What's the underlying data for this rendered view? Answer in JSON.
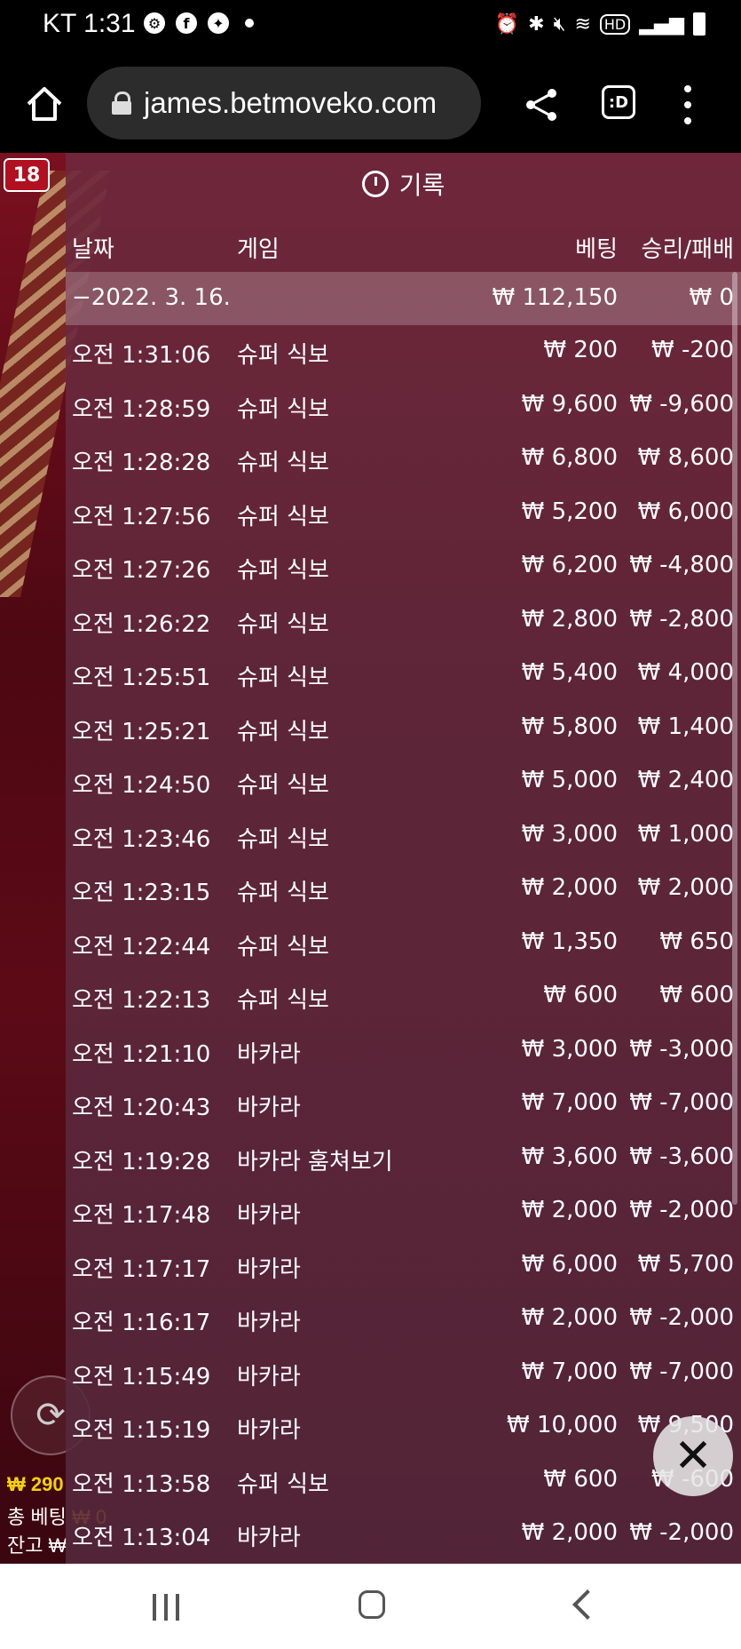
{
  "status_bar": {
    "carrier_time": "KT 1:31",
    "left_icons": [
      "settings-badge-icon",
      "facebook-icon",
      "messenger-icon"
    ],
    "right_hd": "HD"
  },
  "browser": {
    "url": "james.betmoveko.com",
    "tabs_label": ":D"
  },
  "game": {
    "badge": "18",
    "balance_amount": "₩ 290",
    "total_bet_label": "총 베팅",
    "total_bet_value": "₩ 0",
    "remaining_label": "잔고 ₩"
  },
  "history": {
    "title": "기록",
    "headers": {
      "date": "날짜",
      "game": "게임",
      "bet": "베팅",
      "result": "승리/패배"
    },
    "summary": {
      "date": "−2022. 3. 16.",
      "bet": "₩ 112,150",
      "result": "₩ 0"
    },
    "rows": [
      {
        "time": "오전 1:31:06",
        "game": "슈퍼 식보",
        "bet": "₩ 200",
        "result": "₩ -200"
      },
      {
        "time": "오전 1:28:59",
        "game": "슈퍼 식보",
        "bet": "₩ 9,600",
        "result": "₩ -9,600"
      },
      {
        "time": "오전 1:28:28",
        "game": "슈퍼 식보",
        "bet": "₩ 6,800",
        "result": "₩ 8,600"
      },
      {
        "time": "오전 1:27:56",
        "game": "슈퍼 식보",
        "bet": "₩ 5,200",
        "result": "₩ 6,000"
      },
      {
        "time": "오전 1:27:26",
        "game": "슈퍼 식보",
        "bet": "₩ 6,200",
        "result": "₩ -4,800"
      },
      {
        "time": "오전 1:26:22",
        "game": "슈퍼 식보",
        "bet": "₩ 2,800",
        "result": "₩ -2,800"
      },
      {
        "time": "오전 1:25:51",
        "game": "슈퍼 식보",
        "bet": "₩ 5,400",
        "result": "₩ 4,000"
      },
      {
        "time": "오전 1:25:21",
        "game": "슈퍼 식보",
        "bet": "₩ 5,800",
        "result": "₩ 1,400"
      },
      {
        "time": "오전 1:24:50",
        "game": "슈퍼 식보",
        "bet": "₩ 5,000",
        "result": "₩ 2,400"
      },
      {
        "time": "오전 1:23:46",
        "game": "슈퍼 식보",
        "bet": "₩ 3,000",
        "result": "₩ 1,000"
      },
      {
        "time": "오전 1:23:15",
        "game": "슈퍼 식보",
        "bet": "₩ 2,000",
        "result": "₩ 2,000"
      },
      {
        "time": "오전 1:22:44",
        "game": "슈퍼 식보",
        "bet": "₩ 1,350",
        "result": "₩ 650"
      },
      {
        "time": "오전 1:22:13",
        "game": "슈퍼 식보",
        "bet": "₩ 600",
        "result": "₩ 600"
      },
      {
        "time": "오전 1:21:10",
        "game": "바카라",
        "bet": "₩ 3,000",
        "result": "₩ -3,000"
      },
      {
        "time": "오전 1:20:43",
        "game": "바카라",
        "bet": "₩ 7,000",
        "result": "₩ -7,000"
      },
      {
        "time": "오전 1:19:28",
        "game": "바카라 훔쳐보기",
        "bet": "₩ 3,600",
        "result": "₩ -3,600"
      },
      {
        "time": "오전 1:17:48",
        "game": "바카라",
        "bet": "₩ 2,000",
        "result": "₩ -2,000"
      },
      {
        "time": "오전 1:17:17",
        "game": "바카라",
        "bet": "₩ 6,000",
        "result": "₩ 5,700"
      },
      {
        "time": "오전 1:16:17",
        "game": "바카라",
        "bet": "₩ 2,000",
        "result": "₩ -2,000"
      },
      {
        "time": "오전 1:15:49",
        "game": "바카라",
        "bet": "₩ 7,000",
        "result": "₩ -7,000"
      },
      {
        "time": "오전 1:15:19",
        "game": "바카라",
        "bet": "₩ 10,000",
        "result": "₩ 9,500"
      },
      {
        "time": "오전 1:13:58",
        "game": "슈퍼 식보",
        "bet": "₩ 600",
        "result": "₩ -600"
      },
      {
        "time": "오전 1:13:04",
        "game": "바카라",
        "bet": "₩ 2,000",
        "result": "₩ -2,000"
      }
    ],
    "close_icon": "close-icon"
  },
  "colors": {
    "panel": "#6e283c",
    "balance_accent": "#f5d000"
  }
}
